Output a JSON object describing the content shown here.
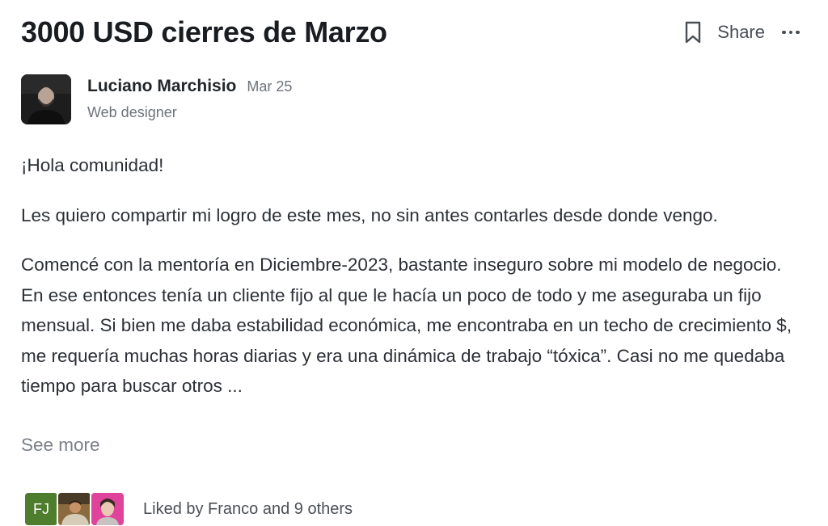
{
  "post": {
    "title": "3000 USD cierres de Marzo",
    "actions": {
      "share_label": "Share",
      "bookmark_icon": "bookmark-icon",
      "more_icon": "more-horizontal-icon"
    },
    "author": {
      "name": "Luciano Marchisio",
      "date": "Mar 25",
      "role": "Web designer"
    },
    "paragraphs": [
      "¡Hola comunidad!",
      "Les quiero compartir mi logro de este mes, no sin antes contarles desde donde vengo.",
      "Comencé con la mentoría en Diciembre-2023, bastante inseguro sobre mi modelo de negocio. En ese entonces tenía un cliente fijo al que le hacía un poco de todo y me aseguraba un fijo mensual. Si bien me daba estabilidad económica, me encontraba en un techo de crecimiento $, me requería muchas horas diarias y era una dinámica de trabajo “tóxica”. Casi no me quedaba tiempo para buscar otros ..."
    ],
    "see_more_label": "See more",
    "likes": {
      "text": "Liked by Franco and 9 others",
      "avatars": [
        {
          "initials": "FJ",
          "color": "#4f7d2e"
        }
      ]
    }
  }
}
